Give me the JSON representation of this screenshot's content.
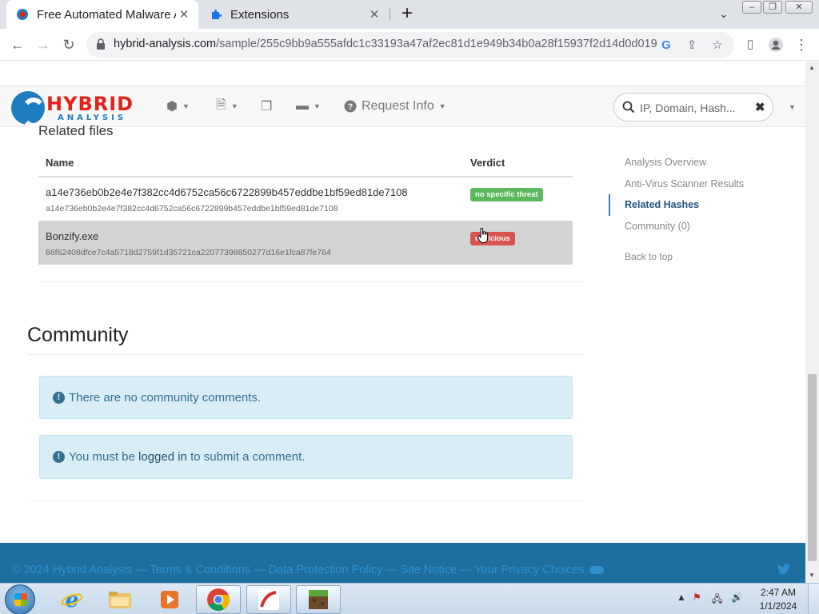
{
  "browser": {
    "tabs": [
      {
        "title": "Free Automated Malware Analysis Service",
        "active": true
      },
      {
        "title": "Extensions",
        "active": false
      }
    ],
    "url_host": "hybrid-analysis.com",
    "url_path": "/sample/255c9bb9a555afdc1c33193a47af2ec81d1e949b34b0a28f15937f2d14d0d019"
  },
  "site": {
    "logo_top": "HYBRID",
    "logo_bottom": "ANALYSIS",
    "nav_request_info": "Request Info",
    "search_placeholder": "IP, Domain, Hash..."
  },
  "related_files": {
    "heading": "Related files",
    "columns": [
      "Name",
      "Verdict"
    ],
    "rows": [
      {
        "name": "a14e736eb0b2e4e7f382cc4d6752ca56c6722899b457eddbe1bf59ed81de7108",
        "hash": "a14e736eb0b2e4e7f382cc4d6752ca56c6722899b457eddbe1bf59ed81de7108",
        "verdict": "no specific threat"
      },
      {
        "name": "Bonzify.exe",
        "hash": "66f62408dfce7c4a5718d2759f1d35721ca22077398850277d16e1fca87fe764",
        "verdict": "malicious"
      }
    ]
  },
  "side_nav": {
    "items": [
      "Analysis Overview",
      "Anti-Virus Scanner Results",
      "Related Hashes",
      "Community (0)"
    ],
    "active_item": "Related Hashes",
    "back_to_top": "Back to top"
  },
  "community": {
    "title": "Community",
    "no_comments": "There are no community comments.",
    "login_prefix": "You must be ",
    "login_link": "logged in",
    "login_suffix": " to submit a comment."
  },
  "footer": {
    "copyright": "© 2024 Hybrid Analysis",
    "links": [
      "Terms & Conditions",
      "Data Protection Policy",
      "Site Notice",
      "Your Privacy Choices"
    ],
    "separator": " — "
  },
  "taskbar": {
    "time": "2:47 AM",
    "date": "1/1/2024"
  },
  "colors": {
    "brand_red": "#e2231a",
    "brand_blue": "#1f7cc0",
    "verdict_clean": "#5cb85c",
    "verdict_malicious": "#d9534f",
    "alert_info_bg": "#d9edf7",
    "footer_bg": "#1e6f9f"
  }
}
